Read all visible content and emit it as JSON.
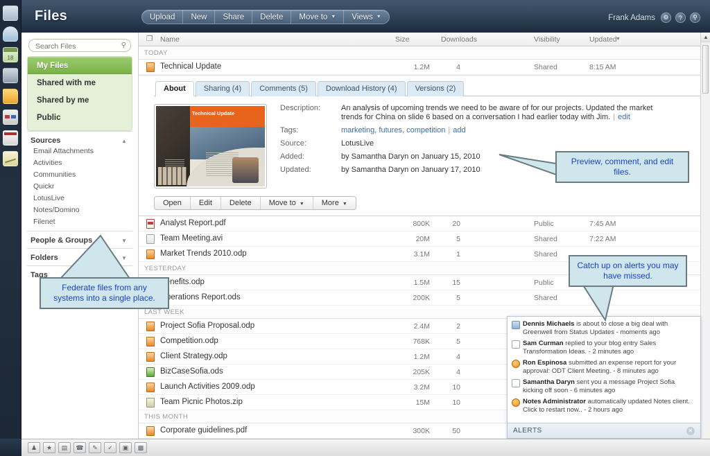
{
  "app": {
    "title": "Files",
    "user": "Frank Adams"
  },
  "header_icons": [
    {
      "name": "gear-icon",
      "glyph": "⚙"
    },
    {
      "name": "help-icon",
      "glyph": "?"
    },
    {
      "name": "search-icon",
      "glyph": "⚲"
    }
  ],
  "toolbar": {
    "buttons": [
      {
        "label": "Upload",
        "caret": false
      },
      {
        "label": "New",
        "caret": false
      },
      {
        "label": "Share",
        "caret": false
      },
      {
        "label": "Delete",
        "caret": false
      },
      {
        "label": "Move to",
        "caret": true
      },
      {
        "label": "Views",
        "caret": true
      }
    ]
  },
  "rail": [
    {
      "name": "home-icon",
      "cls": "ri-home"
    },
    {
      "name": "mail-icon",
      "cls": "ri-mail"
    },
    {
      "name": "calendar-icon",
      "cls": "ri-cal"
    },
    {
      "name": "contacts-icon",
      "cls": "ri-contacts"
    },
    {
      "name": "files-folder-icon",
      "cls": "ri-folder"
    },
    {
      "name": "dashboard-icon",
      "cls": "ri-dash"
    },
    {
      "name": "contact-card-icon",
      "cls": "ri-card"
    },
    {
      "name": "chart-icon",
      "cls": "ri-chart"
    }
  ],
  "sidebar": {
    "search": {
      "placeholder": "Search Files",
      "value": "",
      "icon": "⚲"
    },
    "nav": [
      {
        "label": "My Files",
        "active": true
      },
      {
        "label": "Shared with me",
        "active": false
      },
      {
        "label": "Shared by me",
        "active": false
      },
      {
        "label": "Public",
        "active": false
      }
    ],
    "sections": [
      {
        "label": "Sources",
        "arrow": "▲",
        "items": [
          "Email Attachments",
          "Activities",
          "Communities",
          "Quickr",
          "LotusLive",
          "Notes/Domino",
          "Filenet"
        ]
      },
      {
        "label": "People & Groups",
        "arrow": "▼",
        "items": []
      },
      {
        "label": "Folders",
        "arrow": "▼",
        "items": []
      },
      {
        "label": "Tags",
        "arrow": "▼",
        "items": []
      }
    ]
  },
  "columns": {
    "file_icon": "❐",
    "name": "Name",
    "size": "Size",
    "downloads": "Downloads",
    "visibility": "Visibility",
    "updated": "Updated",
    "sort_caret": "▼"
  },
  "groups": [
    {
      "label": "TODAY",
      "rows": [
        {
          "name": "Technical Update",
          "size": "1.2M",
          "downloads": "4",
          "visibility": "Shared",
          "updated": "8:15 AM",
          "icon": "ic-odp",
          "expanded": true
        },
        {
          "name": "Analyst Report.pdf",
          "size": "800K",
          "downloads": "20",
          "visibility": "Public",
          "updated": "7:45 AM",
          "icon": "ic-pdf"
        },
        {
          "name": "Team Meeting.avi",
          "size": "20M",
          "downloads": "5",
          "visibility": "Shared",
          "updated": "7:22 AM",
          "icon": "ic-avi"
        },
        {
          "name": "Market Trends 2010.odp",
          "size": "3.1M",
          "downloads": "1",
          "visibility": "Shared",
          "updated": "",
          "icon": "ic-odp"
        }
      ]
    },
    {
      "label": "YESTERDAY",
      "rows": [
        {
          "name": "Benefits.odp",
          "size": "1.5M",
          "downloads": "15",
          "visibility": "Public",
          "updated": "",
          "icon": "ic-odp"
        },
        {
          "name": "Operations Report.ods",
          "size": "200K",
          "downloads": "5",
          "visibility": "Shared",
          "updated": "",
          "icon": "ic-ods"
        }
      ]
    },
    {
      "label": "LAST WEEK",
      "rows": [
        {
          "name": "Project Sofia Proposal.odp",
          "size": "2.4M",
          "downloads": "2",
          "visibility": "",
          "updated": "",
          "icon": "ic-odp"
        },
        {
          "name": "Competition.odp",
          "size": "768K",
          "downloads": "5",
          "visibility": "",
          "updated": "",
          "icon": "ic-odp"
        },
        {
          "name": "Client Strategy.odp",
          "size": "1.2M",
          "downloads": "4",
          "visibility": "",
          "updated": "",
          "icon": "ic-odp"
        },
        {
          "name": "BizCaseSofia.ods",
          "size": "205K",
          "downloads": "4",
          "visibility": "",
          "updated": "",
          "icon": "ic-ods"
        },
        {
          "name": "Launch Activities 2009.odp",
          "size": "3.2M",
          "downloads": "10",
          "visibility": "",
          "updated": "",
          "icon": "ic-odp"
        },
        {
          "name": "Team Picnic Photos.zip",
          "size": "15M",
          "downloads": "10",
          "visibility": "",
          "updated": "",
          "icon": "ic-zip"
        }
      ]
    },
    {
      "label": "THIS MONTH",
      "rows": [
        {
          "name": "Corporate guidelines.pdf",
          "size": "300K",
          "downloads": "50",
          "visibility": "",
          "updated": "",
          "icon": "ic-odp"
        }
      ]
    }
  ],
  "detail": {
    "tabs": [
      {
        "label": "About",
        "active": true
      },
      {
        "label": "Sharing (4)",
        "active": false
      },
      {
        "label": "Comments (5)",
        "active": false
      },
      {
        "label": "Download History (4)",
        "active": false
      },
      {
        "label": "Versions (2)",
        "active": false
      }
    ],
    "thumbnail_title": "Technical Update",
    "fields": {
      "description_label": "Description:",
      "description_value": "An analysis of upcoming trends we need to be aware of for our projects. Updated the market trends for China on slide 6 based on a conversation I had earlier today with Jim.",
      "description_edit": "edit",
      "tags_label": "Tags:",
      "tags_value": "marketing, futures, competition",
      "tags_add": "add",
      "source_label": "Source:",
      "source_value": "LotusLive",
      "added_label": "Added:",
      "added_value": "by Samantha Daryn on January 15, 2010",
      "updated_label": "Updated:",
      "updated_value": "by Samantha Daryn on January 17, 2010"
    },
    "actions": [
      {
        "label": "Open",
        "caret": false
      },
      {
        "label": "Edit",
        "caret": false
      },
      {
        "label": "Delete",
        "caret": false
      },
      {
        "label": "Move to",
        "caret": true
      },
      {
        "label": "More",
        "caret": true
      }
    ]
  },
  "alerts": {
    "footer_label": "ALERTS",
    "close_glyph": "✕",
    "items": [
      {
        "icon": "ai-status",
        "actor": "Dennis Michaels",
        "text": " is about to close a big deal with Greenwell from Status Updates - moments ago"
      },
      {
        "icon": "ai-blog",
        "actor": "Sam Curman",
        "text": " replied to your blog entry Sales Transformation Ideas. - 2 minutes ago"
      },
      {
        "icon": "ai-person",
        "actor": "Ron Espinosa",
        "text": " submitted an expense report for your approval: ODT Client Meeting. - 8 minutes ago"
      },
      {
        "icon": "ai-mail",
        "actor": "Samantha Daryn",
        "text": " sent you a message Project Sofia kicking off soon - 6 minutes ago"
      },
      {
        "icon": "ai-person",
        "actor": "Notes Administrator",
        "text": " automatically updated Notes client. Click to restart now.. - 2 hours ago"
      }
    ]
  },
  "callouts": {
    "federate": "Federate files from any systems into a single place.",
    "preview": "Preview, comment, and edit files.",
    "catchup": "Catch up on alerts you may have missed."
  },
  "taskbar": [
    {
      "name": "person-icon",
      "glyph": "♟"
    },
    {
      "name": "star-icon",
      "glyph": "★"
    },
    {
      "name": "calendar-icon",
      "glyph": "▤"
    },
    {
      "name": "phone-icon",
      "glyph": "☎"
    },
    {
      "name": "edit-icon",
      "glyph": "✎"
    },
    {
      "name": "check-icon",
      "glyph": "✓"
    },
    {
      "name": "chat-icon",
      "glyph": "▣"
    },
    {
      "name": "save-icon",
      "glyph": "▩"
    }
  ],
  "scrollbar": {
    "up": "▲",
    "down": "▼"
  },
  "colors": {
    "accent_green": "#7ab348",
    "header_dark": "#1d2c3e",
    "callout_bg": "#cfe7ec",
    "callout_text": "#1b3fcf"
  }
}
